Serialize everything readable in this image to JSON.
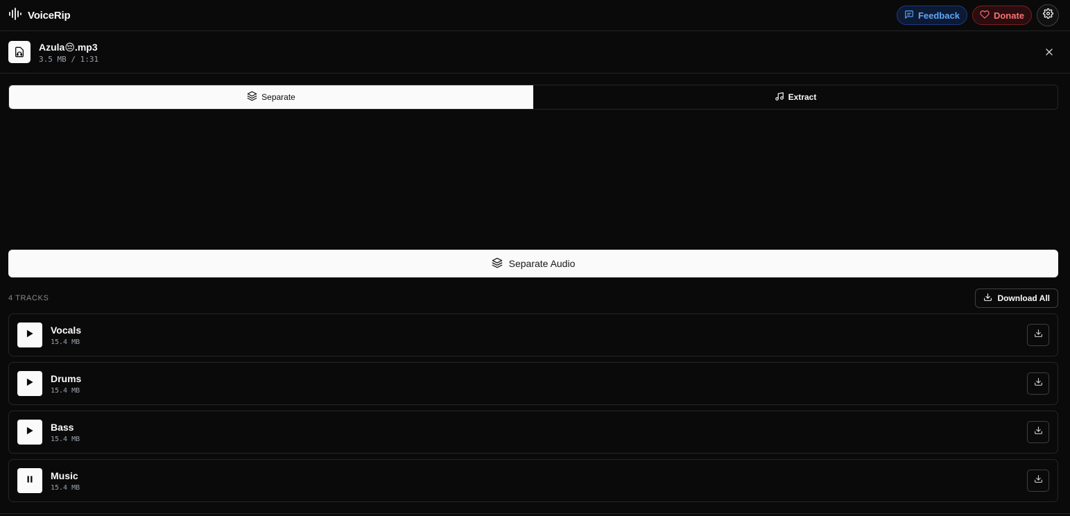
{
  "app": {
    "name": "VoiceRip"
  },
  "header": {
    "feedback_label": "Feedback",
    "donate_label": "Donate"
  },
  "file": {
    "name": "Azula😔.mp3",
    "meta": "3.5 MB / 1:31"
  },
  "tabs": [
    {
      "label": "Separate",
      "active": true,
      "icon": "layers-icon"
    },
    {
      "label": "Extract",
      "active": false,
      "icon": "music-note-icon"
    }
  ],
  "separate_button": {
    "label": "Separate Audio"
  },
  "tracks_header": {
    "count_label": "4 TRACKS",
    "download_all_label": "Download All"
  },
  "tracks": [
    {
      "name": "Vocals",
      "size": "15.4 MB",
      "state": "play"
    },
    {
      "name": "Drums",
      "size": "15.4 MB",
      "state": "play"
    },
    {
      "name": "Bass",
      "size": "15.4 MB",
      "state": "play"
    },
    {
      "name": "Music",
      "size": "15.4 MB",
      "state": "pause"
    }
  ],
  "colors": {
    "background": "#0a0a0a",
    "foreground": "#fafafa",
    "feedback_accent": "#60a5fa",
    "donate_accent": "#f87171"
  }
}
